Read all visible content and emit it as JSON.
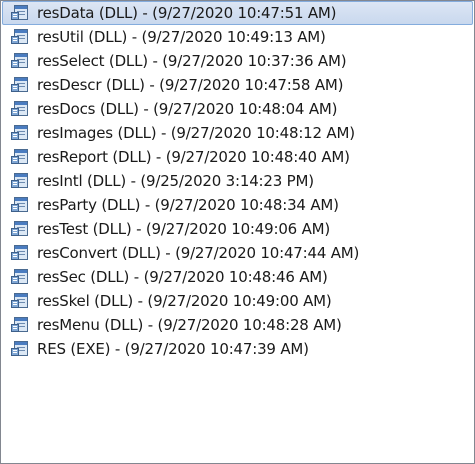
{
  "list": {
    "items": [
      {
        "label": "resData (DLL) - (9/27/2020 10:47:51 AM)",
        "selected": true
      },
      {
        "label": "resUtil (DLL) - (9/27/2020 10:49:13 AM)",
        "selected": false
      },
      {
        "label": "resSelect (DLL) - (9/27/2020 10:37:36 AM)",
        "selected": false
      },
      {
        "label": "resDescr (DLL) - (9/27/2020 10:47:58 AM)",
        "selected": false
      },
      {
        "label": "resDocs (DLL) - (9/27/2020 10:48:04 AM)",
        "selected": false
      },
      {
        "label": "resImages (DLL) - (9/27/2020 10:48:12 AM)",
        "selected": false
      },
      {
        "label": "resReport (DLL) - (9/27/2020 10:48:40 AM)",
        "selected": false
      },
      {
        "label": "resIntl (DLL) - (9/25/2020 3:14:23 PM)",
        "selected": false
      },
      {
        "label": "resParty (DLL) - (9/27/2020 10:48:34 AM)",
        "selected": false
      },
      {
        "label": "resTest (DLL) - (9/27/2020 10:49:06 AM)",
        "selected": false
      },
      {
        "label": "resConvert (DLL) - (9/27/2020 10:47:44 AM)",
        "selected": false
      },
      {
        "label": "resSec (DLL) - (9/27/2020 10:48:46 AM)",
        "selected": false
      },
      {
        "label": "resSkel (DLL) - (9/27/2020 10:49:00 AM)",
        "selected": false
      },
      {
        "label": "resMenu (DLL) - (9/27/2020 10:48:28 AM)",
        "selected": false
      },
      {
        "label": "RES (EXE) - (9/27/2020 10:47:39 AM)",
        "selected": false
      }
    ],
    "item_icon": "module-file-icon",
    "colors": {
      "selection_fill": "#cfdcf0",
      "selection_border": "#84acdd",
      "text": "#1a1a1a",
      "border": "#828790"
    }
  }
}
